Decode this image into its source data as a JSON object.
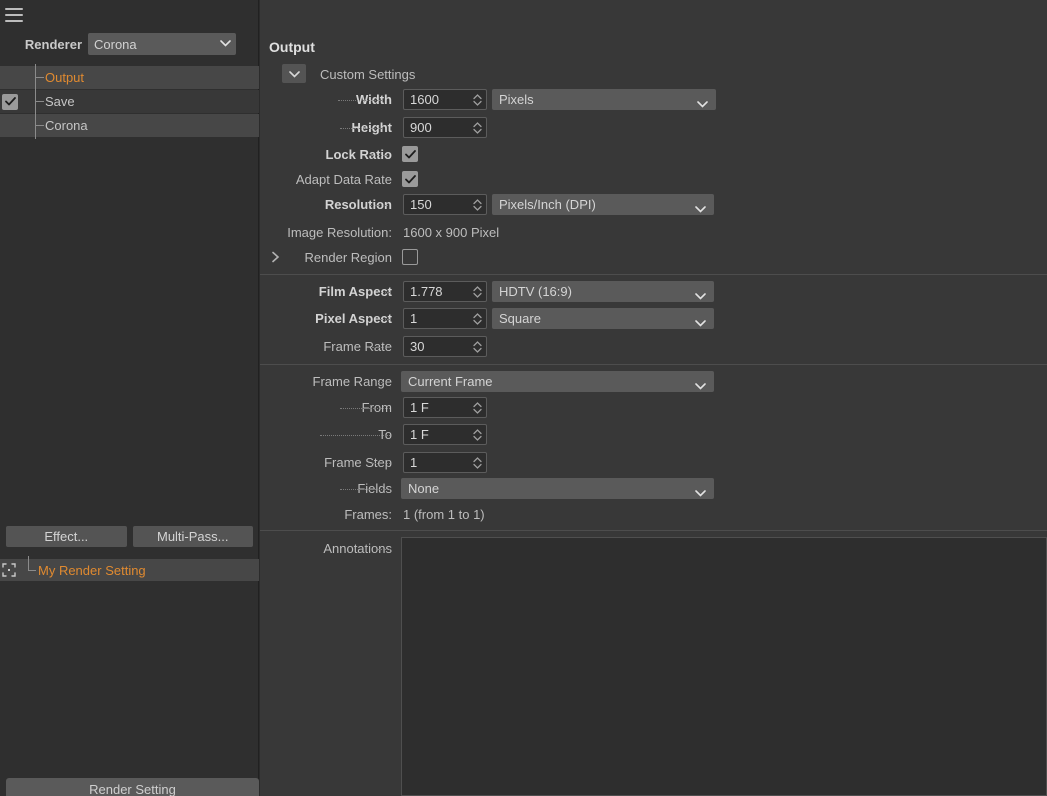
{
  "colors": {
    "accent_orange": "#e08a30",
    "panel_bg": "#2f2f2f",
    "main_bg": "#383838",
    "field_bg": "#2d2d2d",
    "combo_bg": "#5a5a5a"
  },
  "left_panel": {
    "menu_icon": "hamburger-icon",
    "renderer_label": "Renderer",
    "renderer_value": "Corona",
    "tree_items": [
      {
        "label": "Output",
        "selected": true,
        "checkbox": false
      },
      {
        "label": "Save",
        "selected": false,
        "checkbox": true
      },
      {
        "label": "Corona",
        "selected": false,
        "checkbox": false
      }
    ],
    "buttons": {
      "effect": "Effect...",
      "multipass": "Multi-Pass..."
    },
    "render_setting_item": {
      "label": "My Render Setting",
      "icon": "render-region-icon"
    },
    "bottom_tab": "Render Setting"
  },
  "main": {
    "title": "Output",
    "custom_settings_label": "Custom Settings",
    "rows": {
      "width": {
        "label": "Width",
        "value": "1600",
        "unit": "Pixels"
      },
      "height": {
        "label": "Height",
        "value": "900"
      },
      "lock_ratio": {
        "label": "Lock Ratio",
        "checked": true
      },
      "adapt_data_rate": {
        "label": "Adapt Data Rate",
        "checked": true
      },
      "resolution": {
        "label": "Resolution",
        "value": "150",
        "unit": "Pixels/Inch (DPI)"
      },
      "image_resolution": {
        "label": "Image Resolution:",
        "value": "1600 x 900 Pixel"
      },
      "render_region": {
        "label": "Render Region",
        "checked": false
      },
      "film_aspect": {
        "label": "Film Aspect",
        "value": "1.778",
        "preset": "HDTV (16:9)"
      },
      "pixel_aspect": {
        "label": "Pixel Aspect",
        "value": "1",
        "preset": "Square"
      },
      "frame_rate": {
        "label": "Frame Rate",
        "value": "30"
      },
      "frame_range": {
        "label": "Frame Range",
        "value": "Current Frame"
      },
      "from": {
        "label": "From",
        "value": "1 F"
      },
      "to": {
        "label": "To",
        "value": "1 F"
      },
      "frame_step": {
        "label": "Frame Step",
        "value": "1"
      },
      "fields": {
        "label": "Fields",
        "value": "None"
      },
      "frames": {
        "label": "Frames:",
        "value": "1 (from 1 to 1)"
      },
      "annotations": {
        "label": "Annotations",
        "value": ""
      }
    }
  }
}
